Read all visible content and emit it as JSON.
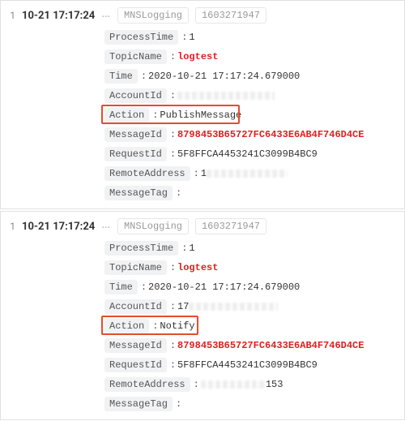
{
  "entries": [
    {
      "row": "1",
      "timestamp": "10-21 17:17:24",
      "tags": [
        "MNSLogging",
        "1603271947"
      ],
      "callout_field_index": 4,
      "fields": [
        {
          "key": "ProcessTime",
          "value": "1",
          "highlight": false,
          "redacted": false
        },
        {
          "key": "TopicName",
          "value": "logtest",
          "highlight": true,
          "redacted": false
        },
        {
          "key": "Time",
          "value": "2020-10-21 17:17:24.679000",
          "highlight": false,
          "redacted": false
        },
        {
          "key": "AccountId",
          "value": "",
          "highlight": false,
          "redacted": true,
          "redacted_w": 120
        },
        {
          "key": "Action",
          "value": "PublishMessage",
          "highlight": false,
          "redacted": false,
          "callout": true
        },
        {
          "key": "MessageId",
          "value": "8798453B65727FC6433E6AB4F746D4CE",
          "highlight": true,
          "redacted": false
        },
        {
          "key": "RequestId",
          "value": "5F8FFCA4453241C3099B4BC9",
          "highlight": false,
          "redacted": false
        },
        {
          "key": "RemoteAddress",
          "value": "1",
          "highlight": false,
          "redacted": true,
          "redacted_w": 100,
          "prefix_visible": "1"
        },
        {
          "key": "MessageTag",
          "value": "",
          "highlight": false,
          "redacted": false
        }
      ]
    },
    {
      "row": "1",
      "timestamp": "10-21 17:17:24",
      "tags": [
        "MNSLogging",
        "1603271947"
      ],
      "callout_field_index": 4,
      "fields": [
        {
          "key": "ProcessTime",
          "value": "1",
          "highlight": false,
          "redacted": false
        },
        {
          "key": "TopicName",
          "value": "logtest",
          "highlight": true,
          "redacted": false
        },
        {
          "key": "Time",
          "value": "2020-10-21 17:17:24.679000",
          "highlight": false,
          "redacted": false
        },
        {
          "key": "AccountId",
          "value": "17",
          "highlight": false,
          "redacted": true,
          "redacted_w": 110,
          "prefix_visible": "17"
        },
        {
          "key": "Action",
          "value": " Notify",
          "highlight": false,
          "redacted": false,
          "callout": true
        },
        {
          "key": "MessageId",
          "value": "8798453B65727FC6433E6AB4F746D4CE",
          "highlight": true,
          "redacted": false
        },
        {
          "key": "RequestId",
          "value": "5F8FFCA4453241C3099B4BC9",
          "highlight": false,
          "redacted": false
        },
        {
          "key": "RemoteAddress",
          "value": "",
          "highlight": false,
          "redacted": true,
          "redacted_w": 80,
          "suffix_visible": "153"
        },
        {
          "key": "MessageTag",
          "value": "",
          "highlight": false,
          "redacted": false
        }
      ]
    }
  ]
}
